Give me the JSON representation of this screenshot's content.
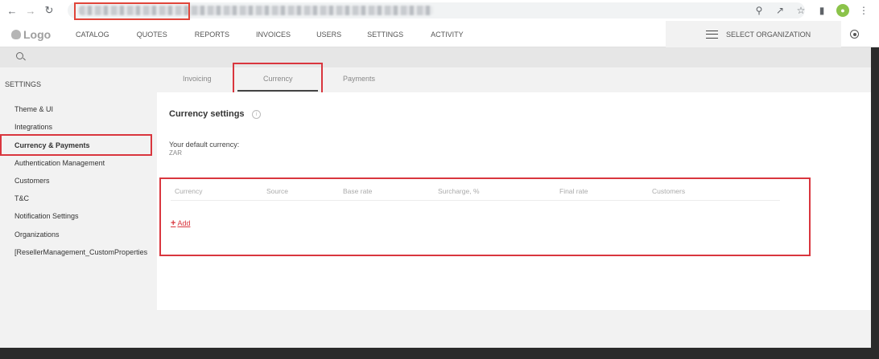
{
  "browser": {
    "back_icon": "arrow-left-icon",
    "forward_icon": "arrow-right-icon",
    "reload_icon": "reload-icon",
    "icons": [
      "zoom-icon",
      "share-icon",
      "star-icon",
      "sidepanel-icon",
      "profile-icon",
      "kebab-menu-icon"
    ]
  },
  "header": {
    "logo_text": "Logo",
    "nav": [
      "CATALOG",
      "QUOTES",
      "REPORTS",
      "INVOICES",
      "USERS",
      "SETTINGS",
      "ACTIVITY"
    ],
    "org_label": "SELECT ORGANIZATION"
  },
  "settings": {
    "title": "SETTINGS",
    "sidebar_items": [
      "Theme & UI",
      "Integrations",
      "Currency & Payments",
      "Authentication Management",
      "Customers",
      "T&C",
      "Notification Settings",
      "Organizations",
      "[ResellerManagement_CustomProperties"
    ],
    "active_item": "Currency & Payments"
  },
  "tabs": [
    "Invoicing",
    "Currency",
    "Payments"
  ],
  "active_tab": "Currency",
  "currency": {
    "heading": "Currency settings",
    "default_label": "Your default currency:",
    "default_value": "ZAR",
    "columns": [
      "Currency",
      "Source",
      "Base rate",
      "Surcharge, %",
      "Final rate",
      "Customers"
    ],
    "add_label": "Add"
  },
  "colors": {
    "highlight": "#d9363e",
    "accent": "#d9363e"
  }
}
